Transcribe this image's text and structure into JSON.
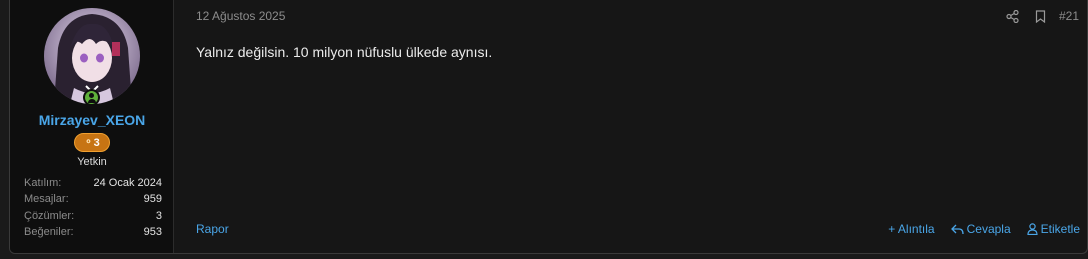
{
  "user": {
    "name": "Mirzayev_XEON",
    "badge_count": "3",
    "title": "Yetkin",
    "stats": [
      {
        "label": "Katılım:",
        "value": "24 Ocak 2024"
      },
      {
        "label": "Mesajlar:",
        "value": "959"
      },
      {
        "label": "Çözümler:",
        "value": "3"
      },
      {
        "label": "Beğeniler:",
        "value": "953"
      }
    ]
  },
  "post": {
    "date": "12 Ağustos 2025",
    "number": "#21",
    "message": "Yalnız değilsin. 10 milyon nüfuslu ülkede aynısı."
  },
  "actions": {
    "report": "Rapor",
    "quote": "+ Alıntıla",
    "reply": "Cevapla",
    "tag": "Etiketle"
  },
  "icons": [
    "share-icon",
    "bookmark-icon",
    "reply-icon",
    "user-icon",
    "drop-icon",
    "online-icon"
  ],
  "colors": {
    "accent": "#4aa6e8",
    "badge": "#c77413",
    "online": "#5fb03a"
  }
}
